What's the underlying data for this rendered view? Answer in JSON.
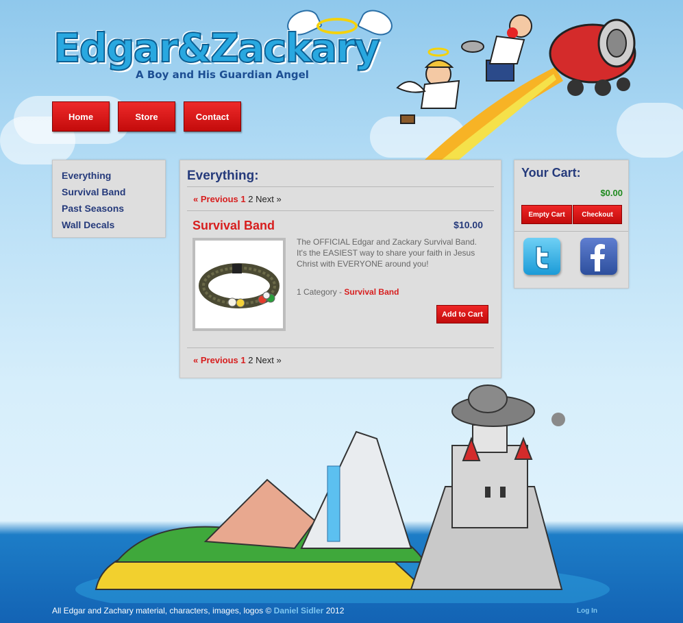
{
  "brand": {
    "title": "Edgar&Zackary",
    "tagline": "A Boy and His Guardian Angel"
  },
  "nav": {
    "home": "Home",
    "store": "Store",
    "contact": "Contact"
  },
  "sidebar": {
    "items": [
      {
        "label": "Everything"
      },
      {
        "label": "Survival Band"
      },
      {
        "label": "Past Seasons"
      },
      {
        "label": "Wall Decals"
      }
    ]
  },
  "main": {
    "heading": "Everything:",
    "pager": {
      "previous": "« Previous",
      "current": "1",
      "page2": "2",
      "next": "Next »"
    },
    "product": {
      "name": "Survival Band",
      "price": "$10.00",
      "description": "The OFFICIAL Edgar and Zackary Survival Band. It's the EASIEST way to share your faith in Jesus Christ with EVERYONE around you!",
      "category_prefix": "1 Category - ",
      "category": "Survival Band",
      "add_label": "Add to Cart"
    }
  },
  "cart": {
    "title": "Your Cart:",
    "total": "$0.00",
    "empty_label": "Empty Cart",
    "checkout_label": "Checkout"
  },
  "footer": {
    "copyright_prefix": "All Edgar and Zachary material, characters, images, logos © ",
    "author": "Daniel Sidler",
    "year": " 2012",
    "login": "Log In"
  },
  "colors": {
    "nav_red": "#d71e1e",
    "link_navy": "#253a7b",
    "price_green": "#1e8a1e",
    "footer_link": "#7ec6f0"
  }
}
